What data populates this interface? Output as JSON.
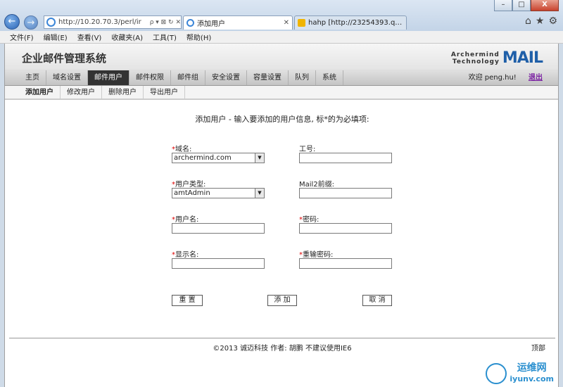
{
  "browser": {
    "url": "http://10.20.70.3/perl/ir",
    "address_controls": "ρ ▾ ⊠ ↻ ✕",
    "tabs": [
      {
        "label": "添加用户",
        "active": true
      },
      {
        "label": "hahp [http://23254393.qzon...",
        "active": false
      }
    ],
    "menu": [
      "文件(F)",
      "编辑(E)",
      "查看(V)",
      "收藏夹(A)",
      "工具(T)",
      "帮助(H)"
    ],
    "window_buttons": [
      "–",
      "□",
      "X"
    ],
    "right_icons": [
      "home-icon",
      "star-icon",
      "gear-icon"
    ]
  },
  "site": {
    "system_name": "企业邮件管理系统",
    "logo_line1": "Archermind",
    "logo_line2": "Technology",
    "logo_mark": "MAIL"
  },
  "nav": {
    "items": [
      "主页",
      "域名设置",
      "邮件用户",
      "邮件权限",
      "邮件组",
      "安全设置",
      "容量设置",
      "队列",
      "系统"
    ],
    "active_index": 2,
    "welcome": "欢迎 peng.hu!",
    "logout": "退出"
  },
  "subnav": {
    "items": [
      "添加用户",
      "修改用户",
      "删除用户",
      "导出用户"
    ],
    "active_index": 0
  },
  "form": {
    "intro": "添加用户 - 输入要添加的用户信息, 标*的为必填项:",
    "required_mark": "*",
    "domain_label": "域名:",
    "domain_value": "archermind.com",
    "employee_id_label": "工号:",
    "employee_id_value": "",
    "user_type_label": "用户类型:",
    "user_type_value": "amtAdmin",
    "mail2_label": "Mail2前缀:",
    "mail2_value": "",
    "username_label": "用户名:",
    "username_value": "",
    "password_label": "密码:",
    "password_value": "",
    "display_name_label": "显示名:",
    "display_name_value": "",
    "confirm_password_label": "重输密码:",
    "confirm_password_value": "",
    "reset_label": "重 置",
    "add_label": "添 加",
    "cancel_label": "取 消"
  },
  "footer": {
    "text": "©2013 诚迈科技    作者: 胡鹏    不建议使用IE6",
    "top_link": "顶部"
  },
  "watermark": {
    "name": "运维网",
    "domain": "iyunv.com"
  }
}
